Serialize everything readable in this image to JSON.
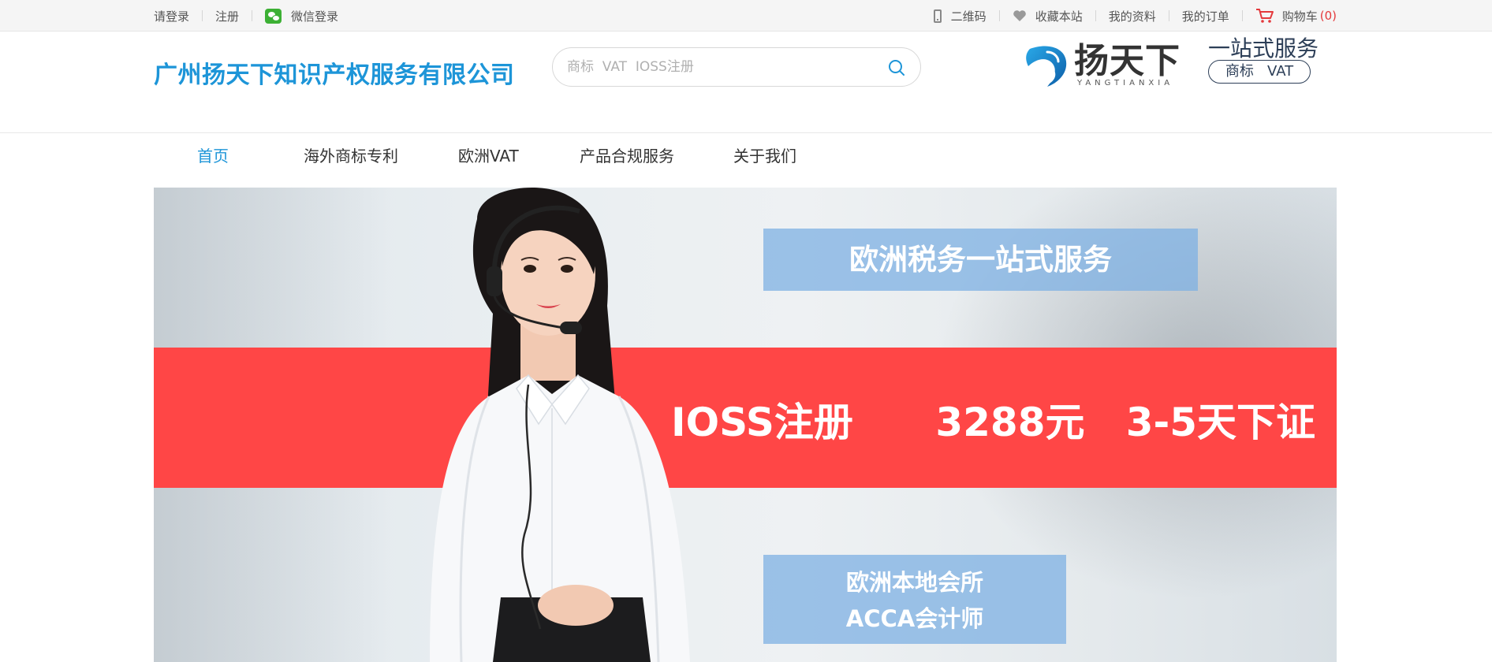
{
  "topbar": {
    "login": "请登录",
    "register": "注册",
    "wechat_login": "微信登录",
    "qrcode": "二维码",
    "bookmark": "收藏本站",
    "profile": "我的资料",
    "orders": "我的订单",
    "cart": "购物车",
    "cart_count": "(0)"
  },
  "header": {
    "company_name": "广州扬天下知识产权服务有限公司",
    "search_placeholder": "商标  VAT  IOSS注册",
    "brand_cn": "扬天下",
    "brand_en": "YANGTIANXIA",
    "slogan": "一站式服务",
    "slogan_tags": "商标   VAT"
  },
  "nav": {
    "items": [
      {
        "label": "首页",
        "active": true
      },
      {
        "label": "海外商标专利",
        "active": false
      },
      {
        "label": "欧洲VAT",
        "active": false
      },
      {
        "label": "产品合规服务",
        "active": false
      },
      {
        "label": "关于我们",
        "active": false
      }
    ]
  },
  "banner": {
    "top_box": "欧洲税务一站式服务",
    "red_text": "IOSS注册      3288元   3-5天下证",
    "bottom_line1": "欧洲本地会所",
    "bottom_line2": "ACCA会计师"
  },
  "colors": {
    "brand_blue": "#1d95d8",
    "banner_red": "#ff4646",
    "box_blue": "#7eb0e3",
    "cart_red": "#e4393c"
  }
}
